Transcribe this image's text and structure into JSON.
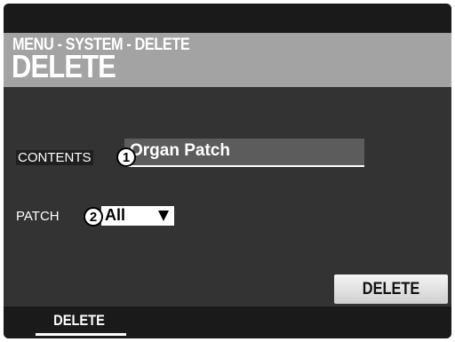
{
  "header": {
    "breadcrumb": "MENU - SYSTEM - DELETE",
    "title": "DELETE"
  },
  "contents": {
    "label": "CONTENTS",
    "value": "Organ Patch",
    "badge": "1"
  },
  "patch": {
    "label": "PATCH",
    "value": "All",
    "badge": "2"
  },
  "actions": {
    "delete_label": "DELETE"
  },
  "tabs": [
    {
      "label": "DELETE"
    }
  ],
  "colors": {
    "panel": "#333333",
    "header": "#a3a3a3",
    "field": "#5c5c5c",
    "text": "#ffffff"
  }
}
